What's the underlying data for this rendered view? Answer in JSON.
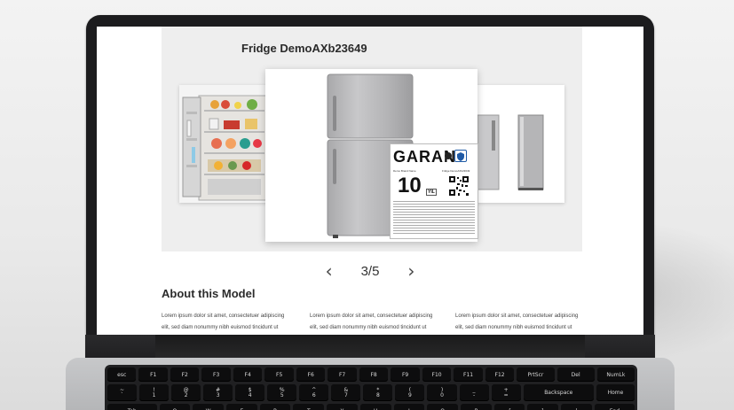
{
  "page": {
    "title": "Fridge DemoAXb23649",
    "pager": {
      "prev": "‹",
      "current": "3/5",
      "next": "›"
    },
    "about": {
      "heading": "About this Model",
      "columns": [
        {
          "line1": "Lorem ipsum dolor sit amet, consectetuer adipiscing",
          "line2": "elit, sed diam nonummy nibh euismod tincidunt ut"
        },
        {
          "line1": "Lorem ipsum dolor sit amet, consectetuer adipiscing",
          "line2": "elit, sed diam nonummy nibh euismod tincidunt ut"
        },
        {
          "line1": "Lorem ipsum dolor sit amet, consectetuer adipiscing",
          "line2": "elit, sed diam nonummy nibh euismod tincidunt ut"
        }
      ]
    },
    "warranty": {
      "brand": "GARAN",
      "small_left": "Demo Brand Name",
      "small_right": "Fridge DemoAXb23649",
      "years": "10",
      "unit": "YIL"
    }
  },
  "keyboard": {
    "function_row": [
      "esc",
      "F1",
      "F2",
      "F3",
      "F4",
      "F5",
      "F6",
      "F7",
      "F8",
      "F9",
      "F10",
      "F11",
      "F12",
      "PrtScr",
      "Del",
      "NumLk"
    ],
    "number_row": [
      {
        "top": "~",
        "bottom": "`"
      },
      {
        "top": "!",
        "bottom": "1"
      },
      {
        "top": "@",
        "bottom": "2"
      },
      {
        "top": "#",
        "bottom": "3"
      },
      {
        "top": "$",
        "bottom": "4"
      },
      {
        "top": "%",
        "bottom": "5"
      },
      {
        "top": "^",
        "bottom": "6"
      },
      {
        "top": "&",
        "bottom": "7"
      },
      {
        "top": "*",
        "bottom": "8"
      },
      {
        "top": "(",
        "bottom": "9"
      },
      {
        "top": ")",
        "bottom": "0"
      },
      {
        "top": "_",
        "bottom": "-"
      },
      {
        "top": "+",
        "bottom": "="
      },
      {
        "top": "Backspace",
        "bottom": ""
      },
      {
        "top": "Home",
        "bottom": ""
      }
    ],
    "tab_row": [
      "Tab",
      "Q",
      "W",
      "E",
      "R",
      "T",
      "Y",
      "U",
      "I",
      "O",
      "P",
      "{",
      "}",
      "|",
      "End"
    ]
  },
  "colors": {
    "screen_bg": "#ffffff",
    "gallery_bg": "#eeeeee",
    "laptop_bezel": "#1c1c1e",
    "fridge_steel": "#b9b9bb"
  }
}
